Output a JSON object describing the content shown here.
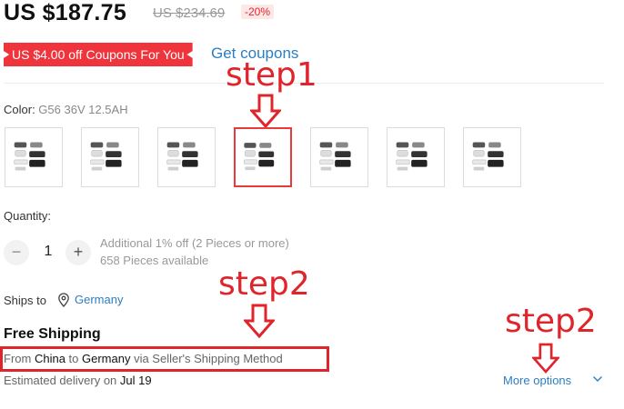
{
  "price": {
    "current": "US $187.75",
    "original": "US $234.69",
    "discount": "-20%"
  },
  "coupon": {
    "badge": "US $4.00 off Coupons For You",
    "link": "Get coupons"
  },
  "color": {
    "label": "Color: ",
    "value": "G56 36V 12.5AH",
    "options_count": 7,
    "selected_index": 3
  },
  "quantity": {
    "label": "Quantity:",
    "minus": "−",
    "value": "1",
    "plus": "+",
    "note1": "Additional 1% off (2 Pieces or more)",
    "note2": "658 Pieces available"
  },
  "shipping": {
    "ships_to": "Ships to",
    "country": "Germany",
    "free": "Free Shipping",
    "from_prefix": "From ",
    "from_country": "China",
    "to_word": " to ",
    "to_country": "Germany",
    "via": " via Seller's Shipping Method",
    "est_prefix": "Estimated delivery on ",
    "est_date": "Jul 19",
    "more_options": "More options"
  },
  "annotations": {
    "step1": "step1",
    "step2a": "step2",
    "step2b": "step2"
  },
  "colors": {
    "accent_red": "#e0242b",
    "link_blue": "#2b7ec3",
    "coupon_bg": "#f0343b"
  }
}
